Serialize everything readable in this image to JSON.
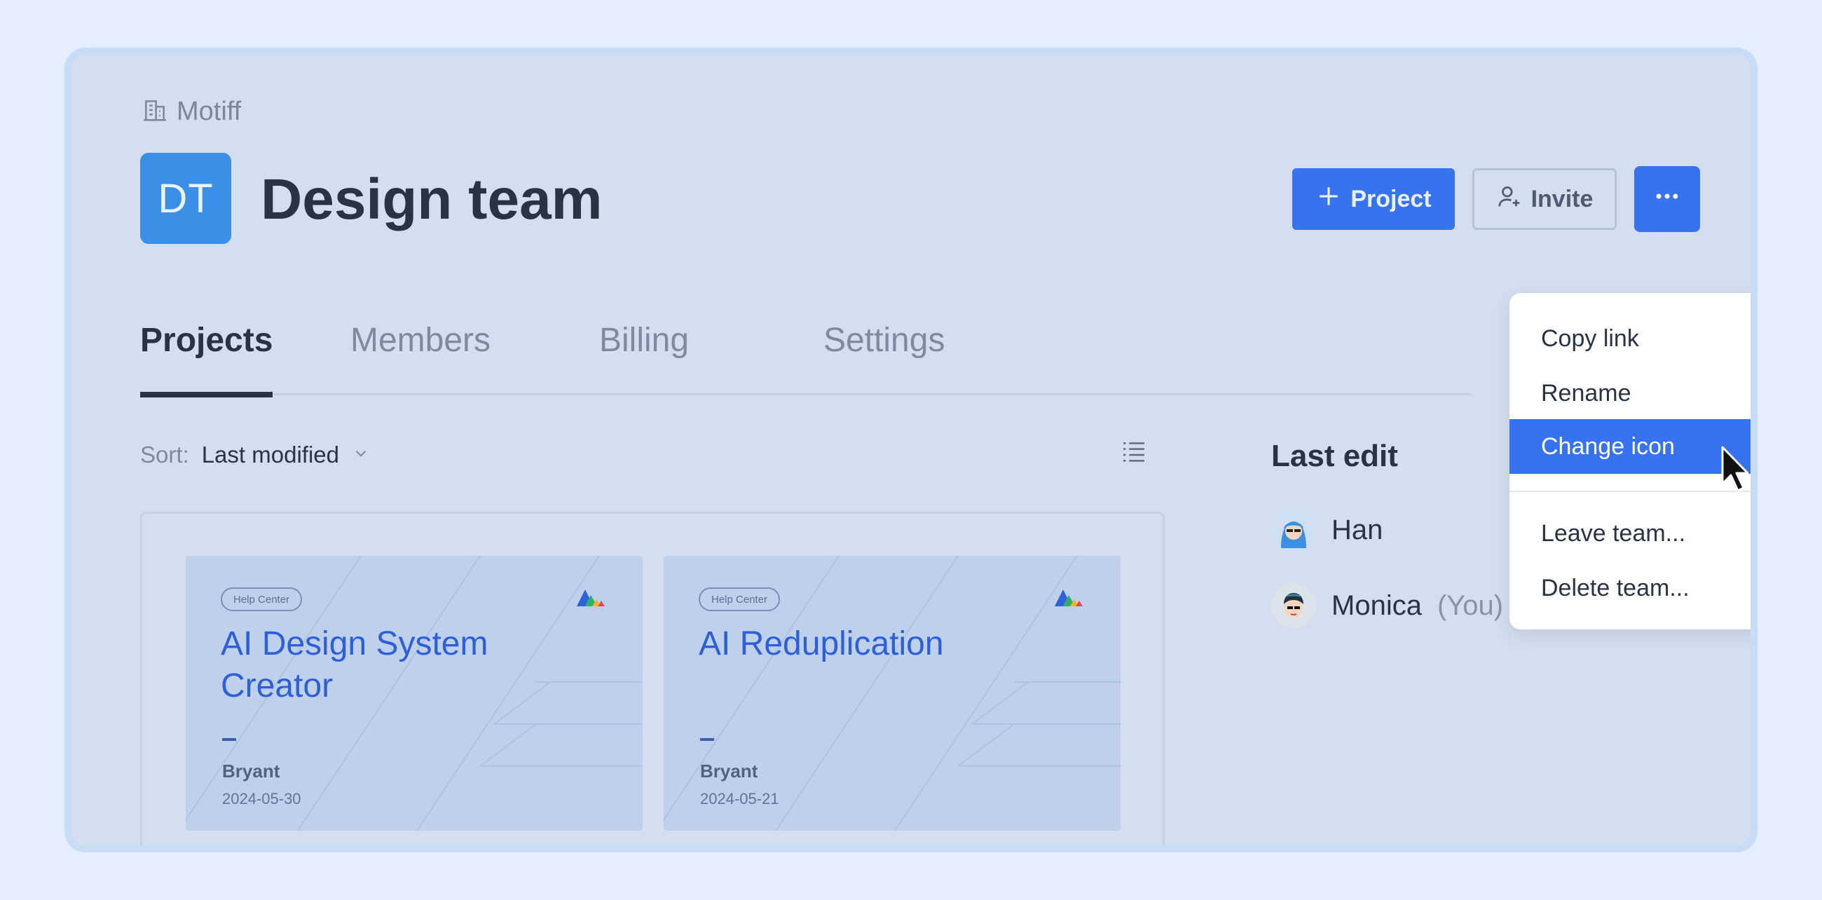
{
  "breadcrumb": {
    "label": "Motiff",
    "icon": "building-icon"
  },
  "team": {
    "initials": "DT",
    "name": "Design team",
    "badge_color": "#3b8fe6"
  },
  "actions": {
    "project_label": "Project",
    "invite_label": "Invite",
    "accent_color": "#3773ef"
  },
  "tabs": [
    {
      "label": "Projects",
      "active": true
    },
    {
      "label": "Members",
      "active": false
    },
    {
      "label": "Billing",
      "active": false
    },
    {
      "label": "Settings",
      "active": false
    }
  ],
  "sort": {
    "label": "Sort:",
    "value": "Last modified"
  },
  "projects": [
    {
      "chip": "Help Center",
      "title": "AI Design System Creator",
      "dash": "–",
      "author": "Bryant",
      "date": "2024-05-30"
    },
    {
      "chip": "Help Center",
      "title": "AI Reduplication",
      "dash": "–",
      "author": "Bryant",
      "date": "2024-05-21"
    }
  ],
  "last_edit": {
    "title": "Last edit",
    "editors": [
      {
        "name": "Han",
        "suffix": ""
      },
      {
        "name": "Monica",
        "suffix": "(You)"
      }
    ]
  },
  "menu": {
    "items": [
      {
        "label": "Copy link"
      },
      {
        "label": "Rename"
      },
      {
        "label": "Change icon",
        "highlighted": true
      },
      {
        "label": "Leave team..."
      },
      {
        "label": "Delete team..."
      }
    ]
  }
}
